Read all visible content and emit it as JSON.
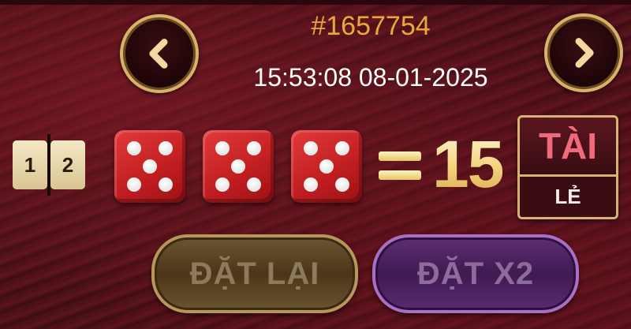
{
  "header": {
    "session_id": "#1657754",
    "datetime": "15:53:08 08-01-2025"
  },
  "nav": {
    "prev_icon": "chevron-left-icon",
    "next_icon": "chevron-right-icon"
  },
  "dice_count": {
    "left": "1",
    "right": "2"
  },
  "dice": [
    5,
    5,
    5
  ],
  "total": "15",
  "result": {
    "top": "TÀI",
    "bottom": "LẺ"
  },
  "buttons": {
    "reset_label": "ĐẶT LẠI",
    "double_label": "ĐẶT X2"
  },
  "colors": {
    "session_id": "#e8a93a",
    "die": "#c41f22",
    "result_top": "#ef6a7a"
  }
}
